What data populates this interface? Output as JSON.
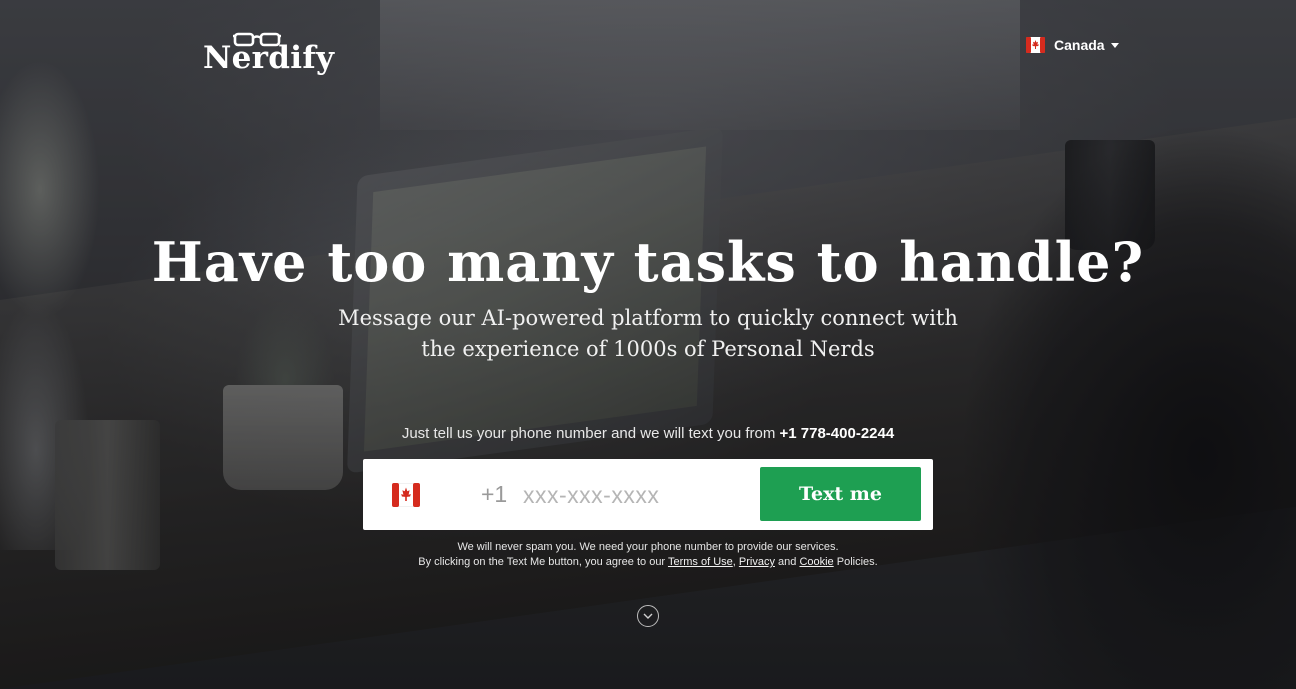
{
  "brand": {
    "logo_text": "Nerdify"
  },
  "header": {
    "country_label": "Canada",
    "country_flag_icon": "canada-flag-icon"
  },
  "hero": {
    "headline": "Have too many tasks to handle?",
    "subline_1": "Message our AI-powered platform to quickly connect with",
    "subline_2": "the experience of 1000s of Personal Nerds",
    "tell_us_text": "Just tell us your phone number and we will text you from",
    "sender_number": "+1 778-400-2244"
  },
  "form": {
    "dial_code": "+1",
    "phone_placeholder": "xxx-xxx-xxxx",
    "phone_value": "",
    "submit_label": "Text me",
    "flag_icon": "canada-flag-icon"
  },
  "disclaimer": {
    "line_1": "We will never spam you. We need your phone number to provide our services.",
    "line_2_prefix": "By clicking on the Text Me button, you agree to our",
    "terms_label": "Terms of Use",
    "comma": ",",
    "privacy_label": "Privacy",
    "and_text": "and",
    "cookie_label": "Cookie",
    "suffix": "Policies."
  },
  "scroll_icon": "chevron-down-circle-icon",
  "colors": {
    "accent_green": "#1e9f52",
    "flag_red": "#d52b1e",
    "text_white": "#ffffff"
  }
}
